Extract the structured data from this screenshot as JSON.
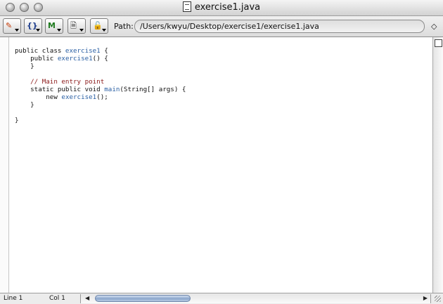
{
  "window": {
    "title": "exercise1.java"
  },
  "toolbar": {
    "path_label": "Path:",
    "path_value": "/Users/kwyu/Desktop/exercise1/exercise1.java",
    "buttons": [
      {
        "name": "markers-popup",
        "icon": "pen-icon"
      },
      {
        "name": "functions-popup",
        "glyph": "{}"
      },
      {
        "name": "macros-popup",
        "glyph": "M"
      },
      {
        "name": "document-popup",
        "icon": "document-icon"
      },
      {
        "name": "lock-popup",
        "icon": "lock-icon"
      }
    ]
  },
  "code": {
    "line1": {
      "kw": "public class ",
      "cls": "exercise1",
      "tail": " {"
    },
    "line2": {
      "indent": "    ",
      "kw": "public ",
      "fn": "exercise1",
      "tail": "() {"
    },
    "line3": "    }",
    "line5": "    // Main entry point",
    "line6": {
      "indent": "    ",
      "kw": "static public void ",
      "fn": "main",
      "tail": "(String[] args) {"
    },
    "line7": {
      "indent": "        ",
      "kw": "new ",
      "fn": "exercise1",
      "tail": "();"
    },
    "line8": "    }",
    "line10": "}"
  },
  "status": {
    "line": "Line 1",
    "col": "Col 1"
  },
  "colors": {
    "keyword": "#111111",
    "identifier": "#2b60a4",
    "comment": "#8b1a1a"
  }
}
